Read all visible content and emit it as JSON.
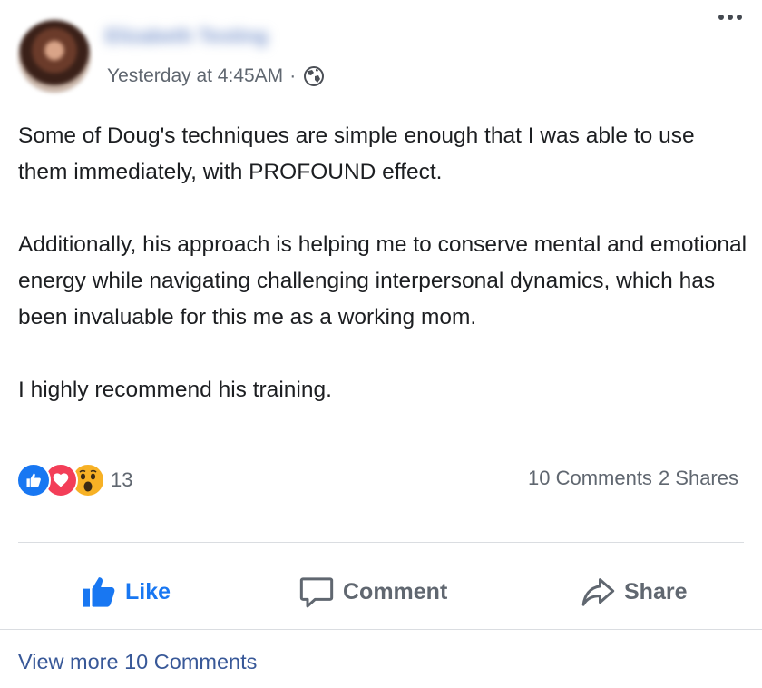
{
  "post": {
    "author_name": "Elizabeth Testing",
    "timestamp": "Yesterday at 4:45AM",
    "separator": "·",
    "privacy_icon": "globe-icon",
    "more_icon": "more-horizontal-icon",
    "paragraphs": [
      "Some of Doug's techniques are simple enough that I was able to use them immediately, with PROFOUND effect.",
      "Additionally, his approach is helping me to conserve mental and emotional energy while navigating challenging interpersonal dynamics, which has been invaluable for this me as a working mom.",
      "I highly recommend his training."
    ]
  },
  "reactions": {
    "types": [
      "like",
      "love",
      "wow"
    ],
    "count": "13",
    "comments": "10 Comments",
    "shares": "2 Shares"
  },
  "actions": {
    "like": "Like",
    "comment": "Comment",
    "share": "Share"
  },
  "view_more": "View more 10 Comments",
  "colors": {
    "brand_blue": "#1877f2",
    "link_blue": "#385898",
    "secondary_text": "#606770",
    "love_red": "#f33e58",
    "wow_yellow": "#f7b125"
  }
}
